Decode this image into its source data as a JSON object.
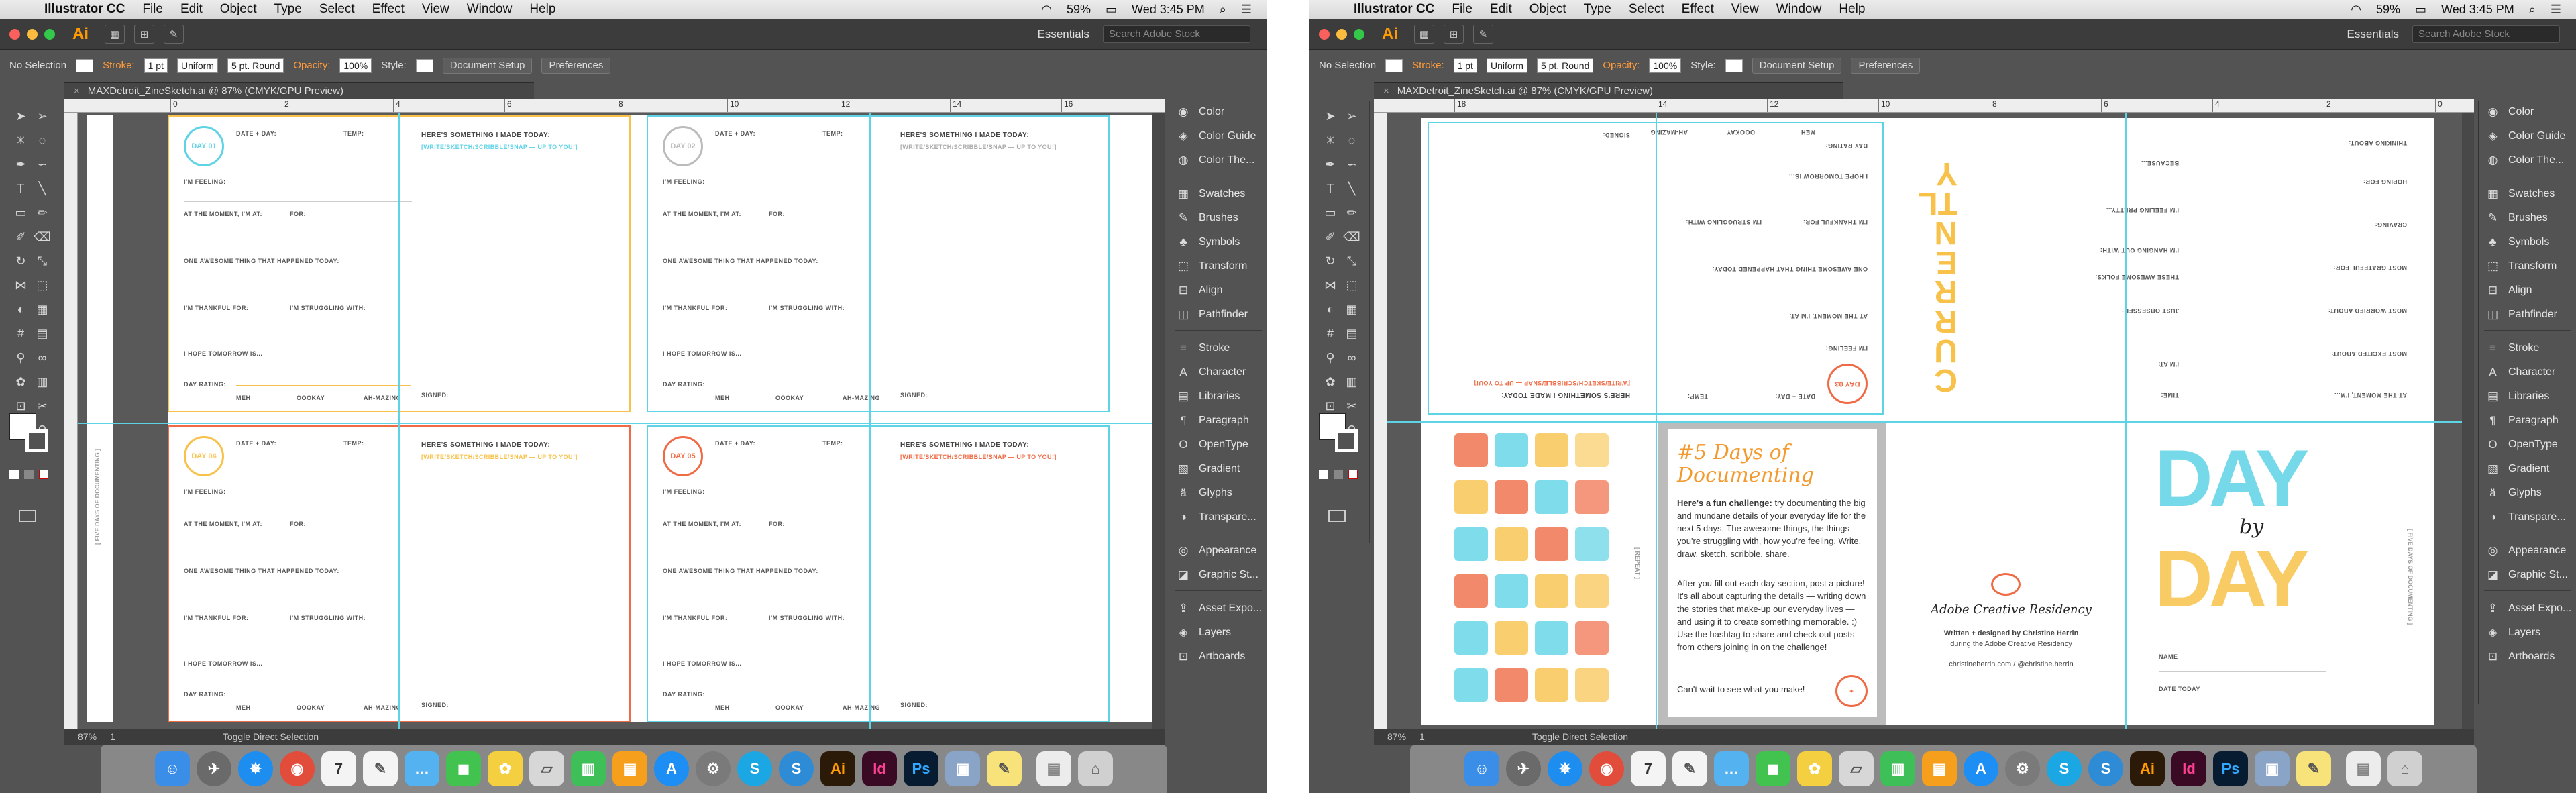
{
  "menubar": {
    "app": "Illustrator CC",
    "items": [
      "File",
      "Edit",
      "Object",
      "Type",
      "Select",
      "Effect",
      "View",
      "Window",
      "Help"
    ],
    "battery": "59%",
    "clock": "Wed 3:45 PM"
  },
  "appbar": {
    "logo": "Ai",
    "workspace": "Essentials",
    "search_placeholder": "Search Adobe Stock"
  },
  "control": {
    "selection": "No Selection",
    "stroke_label": "Stroke:",
    "stroke_weight": "1 pt",
    "profile": "Uniform",
    "brush": "5 pt. Round",
    "opacity_label": "Opacity:",
    "opacity": "100%",
    "style_label": "Style:",
    "doc_setup": "Document Setup",
    "preferences": "Preferences"
  },
  "document": {
    "tab": "MAXDetroit_ZineSketch.ai @ 87% (CMYK/GPU Preview)",
    "zoom": "87%",
    "status": "Toggle Direct Selection",
    "page": "1"
  },
  "ruler_left": [
    "0",
    "2",
    "4",
    "6",
    "8",
    "10",
    "12",
    "14",
    "16"
  ],
  "ruler_right": [
    "18",
    "14",
    "12",
    "10",
    "8",
    "6",
    "4",
    "2",
    "0"
  ],
  "panels": [
    "Color",
    "Color Guide",
    "Color The...",
    "Swatches",
    "Brushes",
    "Symbols",
    "Transform",
    "Align",
    "Pathfinder",
    "Stroke",
    "Character",
    "Libraries",
    "Paragraph",
    "OpenType",
    "Gradient",
    "Glyphs",
    "Transpare...",
    "Appearance",
    "Graphic St...",
    "Asset Expo...",
    "Layers",
    "Artboards"
  ],
  "journal": {
    "date_day": "DATE + DAY:",
    "temp": "TEMP:",
    "here": "HERE'S SOMETHING I MADE TODAY:",
    "prompt": "[WRITE/SKETCH/SCRIBBLE/SNAP — UP TO YOU!]",
    "feeling": "I'M FEELING:",
    "moment": "AT THE MOMENT, I'M AT:",
    "for": "FOR:",
    "awesome": "ONE AWESOME THING THAT HAPPENED TODAY:",
    "thankful": "I'M THANKFUL FOR:",
    "struggling": "I'M STRUGGLING WITH:",
    "tomorrow": "I HOPE TOMORROW IS...",
    "rating": "DAY RATING:",
    "meh": "MEH",
    "oookay": "OOOKAY",
    "amazing": "AH-MAZING",
    "signed": "SIGNED:",
    "day1": "DAY 01",
    "day2": "DAY 02",
    "day3": "DAY 03",
    "day4": "DAY 04",
    "day5": "DAY 05",
    "spine": "[ FIVE DAYS OF DOCUMENTING ]"
  },
  "right": {
    "title": "#5 Days of Documenting",
    "challenge_bold": "Here's a fun challenge:",
    "challenge": "try documenting the big and mundane details of your everyday life for the next 5 days. The awesome things, the things you're struggling with, how you're feeling. Write, draw, sketch, scribble, share.",
    "after": "After you fill out each day section, post a picture! It's all about capturing the details — writing down the stories that make-up our everyday lives — and using it to create something memorable. :) Use the hashtag to share and check out posts from others joining in on the challenge!",
    "cant_wait": "Can't wait to see what you make!",
    "residency": "Adobe Creative Residency",
    "credit1": "Written + designed by Christine Herrin",
    "credit2": "during the Adobe Creative Residency",
    "links": "christineherrin.com  /  @christine.herrin",
    "currently": "CURRENTLY",
    "day": "DAY",
    "by": "by",
    "name": "NAME",
    "date_today": "DATE TODAY",
    "repeat": "[ REPEAT ]",
    "spine": "[ FIVE DAYS OF DOCUMENTING ]",
    "q_feeling": "I'M FEELING PRETTY...",
    "q_hanging": "I'M HANGING OUT WITH:",
    "q_these": "THESE AWESOME FOLKS:",
    "q_obsessed": "JUST OBSESSED:",
    "q_excited": "MOST EXCITED ABOUT:",
    "q_worried": "MOST WORRIED ABOUT:",
    "q_grateful": "MOST GRATEFUL FOR:",
    "q_craving": "CRAVING:",
    "q_hoping": "HOPING FOR:",
    "q_thinking": "THINKING ABOUT:",
    "q_because": "BECAUSE...",
    "q_time": "TIME:",
    "q_at": "I'M AT:",
    "q_moment": "AT THE MOMENT, I'M..."
  },
  "colors": {
    "yellow": "#f8c24a",
    "blue": "#5fd3e6",
    "red": "#ef6b45",
    "orange": "#ff9a3a",
    "guide": "#5fd3e6"
  }
}
